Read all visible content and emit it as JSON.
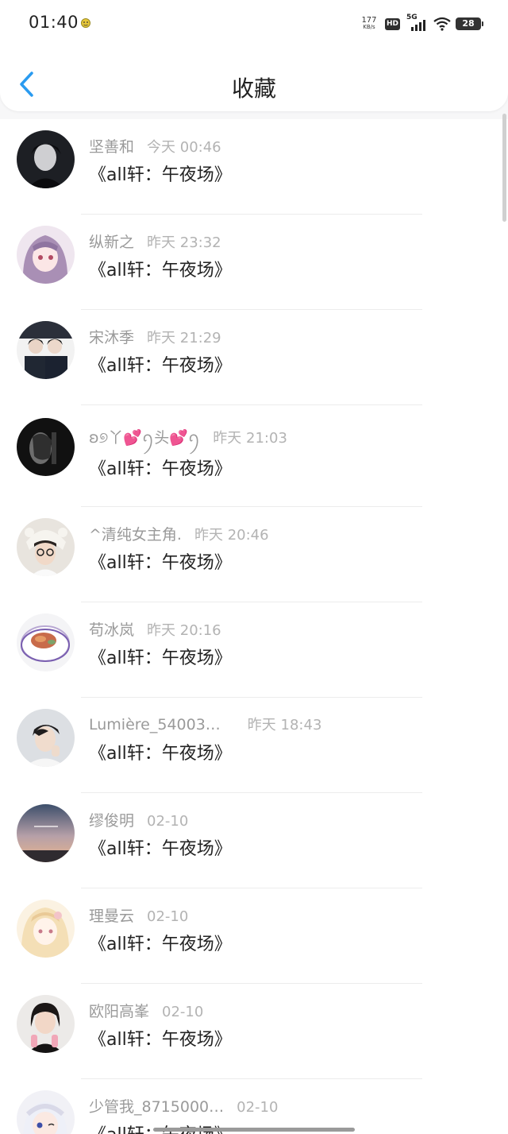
{
  "status_bar": {
    "time": "01:40",
    "net_speed_value": "177",
    "net_speed_unit": "KB/s",
    "hd": "HD",
    "network": "5G",
    "battery": "28"
  },
  "header": {
    "title": "收藏",
    "back_icon": "chevron-left-icon"
  },
  "colors": {
    "accent": "#2a9bf0",
    "text": "#222222",
    "muted": "#9a9a9a"
  },
  "items": [
    {
      "user": "坚善和",
      "time": "今天 00:46",
      "work": "《all轩：午夜场》"
    },
    {
      "user": "纵新之",
      "time": "昨天 23:32",
      "work": "《all轩：午夜场》"
    },
    {
      "user": "宋沐季",
      "time": "昨天 21:29",
      "work": "《all轩：午夜场》"
    },
    {
      "user": "ʚ୭丫💕ꪆ头💕ꪆ",
      "time": "昨天 21:03",
      "work": "《all轩：午夜场》"
    },
    {
      "user": "^清纯女主角.",
      "time": "昨天 20:46",
      "work": "《all轩：午夜场》"
    },
    {
      "user": "苟冰岚",
      "time": "昨天 20:16",
      "work": "《all轩：午夜场》"
    },
    {
      "user": "Lumière_54003…",
      "time": "昨天 18:43",
      "work": "《all轩：午夜场》"
    },
    {
      "user": "缪俊明",
      "time": "02-10",
      "work": "《all轩：午夜场》"
    },
    {
      "user": "理曼云",
      "time": "02-10",
      "work": "《all轩：午夜场》"
    },
    {
      "user": "欧阳高峯",
      "time": "02-10",
      "work": "《all轩：午夜场》"
    },
    {
      "user": "少管我_8715000…",
      "time": "02-10",
      "work": "《all轩：午夜场》"
    }
  ]
}
